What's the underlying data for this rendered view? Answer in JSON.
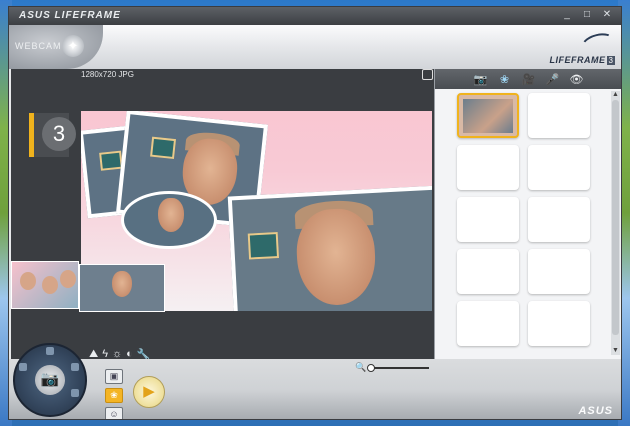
{
  "titlebar": {
    "brand": "ASUS LIFEFRAME",
    "controls": [
      "_",
      "□",
      "✕"
    ]
  },
  "header": {
    "webcam_label": "WEBCAM",
    "logo_text": "LIFEFRAME",
    "logo_num": "3"
  },
  "preview": {
    "info": "1280x720 JPG",
    "countdown": "3"
  },
  "tools": {
    "icons": [
      "⛰",
      "ϟ",
      "☼",
      "◐",
      "🔧"
    ]
  },
  "right_panel": {
    "tabs": [
      "📷",
      "❀",
      "🎥",
      "🎤",
      "👁"
    ],
    "active_tab_index": 1,
    "thumbnail_count": 10,
    "selected_index": 0
  },
  "bottom": {
    "mode_buttons": [
      "▣",
      "❀",
      "☺"
    ],
    "active_mode_index": 1,
    "play": "▶",
    "zoom_icon": "🔍",
    "footer_brand": "ASUS"
  }
}
